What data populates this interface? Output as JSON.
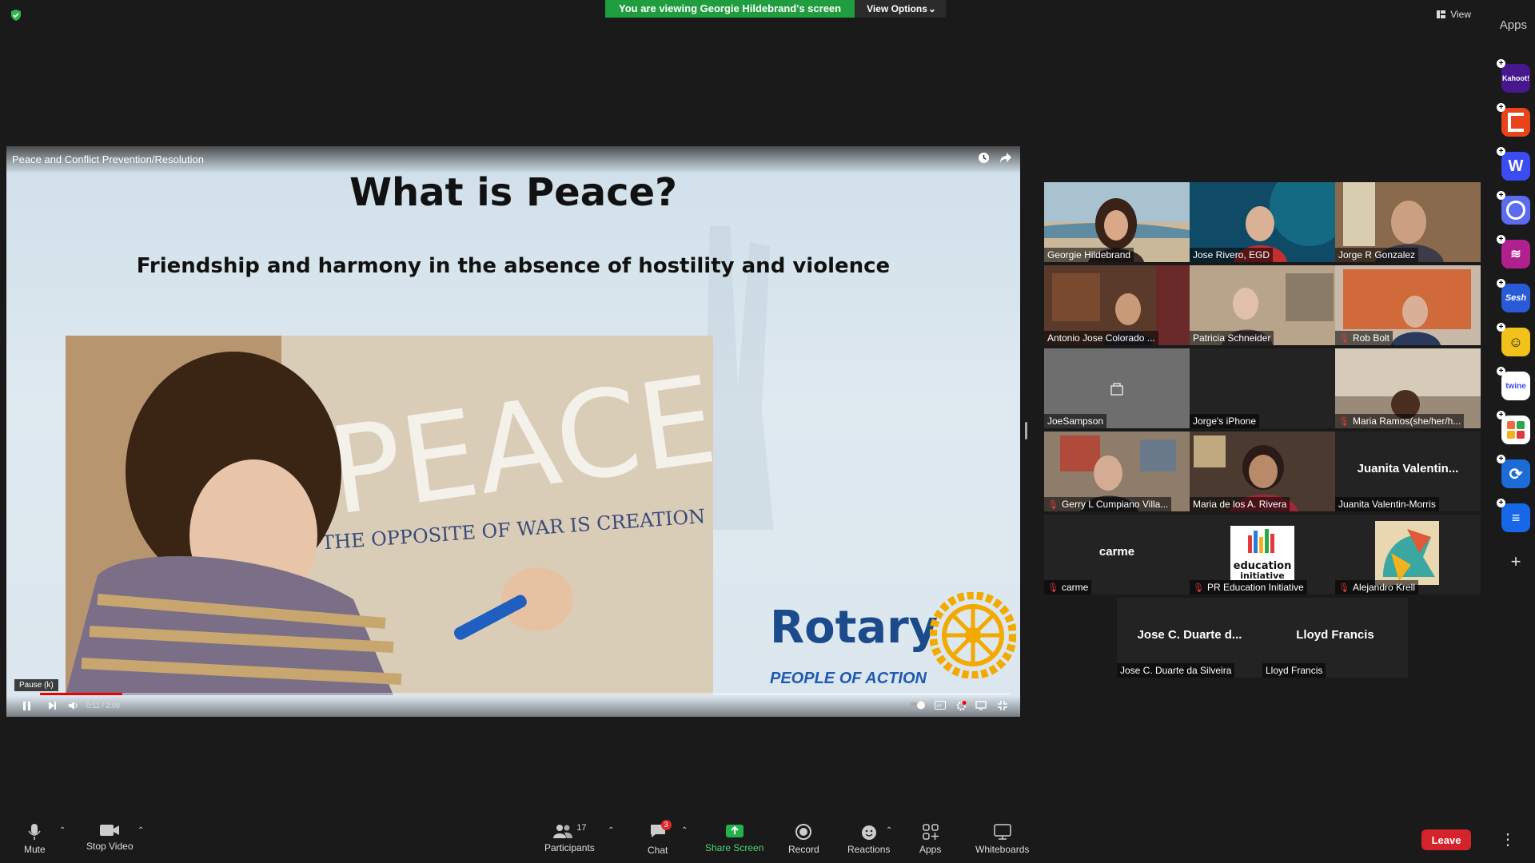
{
  "banner": {
    "viewing_text": "You are viewing Georgie Hildebrand's screen",
    "view_options_label": "View Options"
  },
  "top_right": {
    "view_label": "View",
    "apps_title": "Apps"
  },
  "share": {
    "window_title": "Peace and Conflict Prevention/Resolution",
    "slide_heading": "What is Peace?",
    "slide_subheading": "Friendship and harmony in the absence of hostility and violence",
    "logo_word": "Rotary",
    "logo_tagline": "PEOPLE OF ACTION",
    "player": {
      "tooltip": "Pause (k)",
      "time": "0:11 / 2:09",
      "progress": 0.085
    }
  },
  "participants": [
    {
      "name": "Georgie Hildebrand",
      "muted": false,
      "active": true
    },
    {
      "name": "Jose Rivero, EGD",
      "muted": false
    },
    {
      "name": "Jorge R Gonzalez",
      "muted": false
    },
    {
      "name": "Antonio Jose Colorado ...",
      "muted": false
    },
    {
      "name": "Patricia Schneider",
      "muted": false
    },
    {
      "name": "Rob Bolt",
      "muted": true
    },
    {
      "name": "JoeSampson",
      "muted": false
    },
    {
      "name": "Jorge's iPhone",
      "muted": false
    },
    {
      "name": "Maria Ramos(she/her/h...",
      "muted": true
    },
    {
      "name": "Gerry L Cumpiano Villa...",
      "muted": true
    },
    {
      "name": "Maria de los A. Rivera",
      "muted": false
    },
    {
      "name": "Juanita Valentin-Morris",
      "big_name": "Juanita Valentin...",
      "muted": false
    },
    {
      "name": "carme",
      "big_name": "carme",
      "muted": true
    },
    {
      "name": "PR Education Initiative",
      "muted": true
    },
    {
      "name": "Alejandro Krell",
      "muted": true
    },
    {
      "name": "Jose C. Duarte da Silveira",
      "big_name": "Jose C. Duarte d...",
      "muted": false
    },
    {
      "name": "Lloyd Francis",
      "big_name": "Lloyd Francis",
      "muted": false
    }
  ],
  "apps": [
    {
      "label": "Kahoot!",
      "icon": "kahoot-icon",
      "color": "#46178f"
    },
    {
      "label": "",
      "icon": "app-orange-icon",
      "color": "#e8431b"
    },
    {
      "label": "W",
      "icon": "wooclap-icon",
      "color": "#3b4cf2"
    },
    {
      "label": "",
      "icon": "app-chat-icon",
      "color": "#5b6cf0"
    },
    {
      "label": "",
      "icon": "app-magenta-icon",
      "color": "#b0208f"
    },
    {
      "label": "Sesh",
      "icon": "sesh-icon",
      "color": "#2a5bd7"
    },
    {
      "label": "",
      "icon": "app-yellow-icon",
      "color": "#f2c21b"
    },
    {
      "label": "twine",
      "icon": "twine-icon",
      "color": "#ffffff"
    },
    {
      "label": "",
      "icon": "app-grid-icon",
      "color": "#f06a3b"
    },
    {
      "label": "",
      "icon": "app-sync-icon",
      "color": "#1c6bd6"
    },
    {
      "label": "",
      "icon": "app-blue-icon",
      "color": "#1768e8"
    }
  ],
  "toolbar": {
    "mute": "Mute",
    "stop_video": "Stop Video",
    "participants": "Participants",
    "participants_count": "17",
    "chat": "Chat",
    "chat_badge": "3",
    "share_screen": "Share Screen",
    "record": "Record",
    "reactions": "Reactions",
    "apps": "Apps",
    "whiteboards": "Whiteboards",
    "leave": "Leave"
  },
  "colors": {
    "accent_green": "#1f9d3f",
    "leave_red": "#d3242c",
    "active_speaker": "#e8e02e"
  }
}
